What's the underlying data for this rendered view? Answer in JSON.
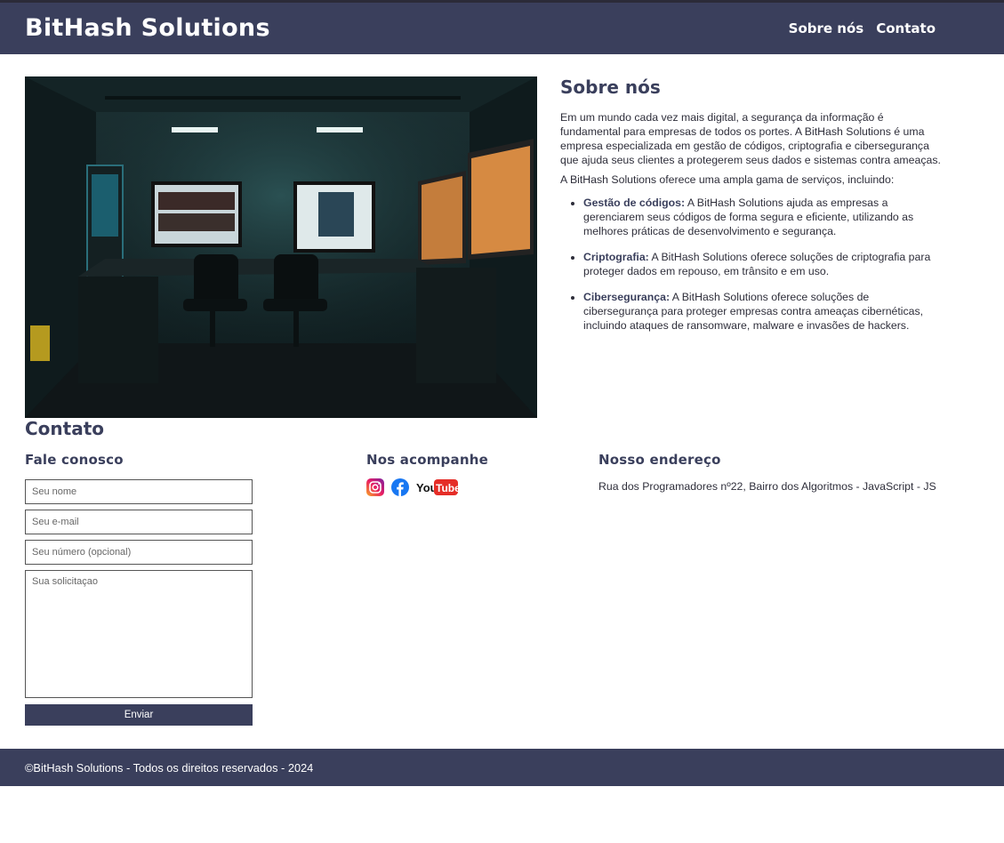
{
  "header": {
    "brand": "BitHash Solutions",
    "nav": [
      "Sobre nós",
      "Contato"
    ]
  },
  "about": {
    "title": "Sobre nós",
    "paragraph1": "Em um mundo cada vez mais digital, a segurança da informação é fundamental para empresas de todos os portes. A BitHash Solutions é uma empresa especializada em gestão de códigos, criptografia e cibersegurança que ajuda seus clientes a protegerem seus dados e sistemas contra ameaças.",
    "paragraph2": "A BitHash Solutions oferece uma ampla gama de serviços, incluindo:",
    "services": [
      {
        "name": "Gestão de códigos:",
        "text": " A BitHash Solutions ajuda as empresas a gerenciarem seus códigos de forma segura e eficiente, utilizando as melhores práticas de desenvolvimento e segurança."
      },
      {
        "name": "Criptografia:",
        "text": " A BitHash Solutions oferece soluções de criptografia para proteger dados em repouso, em trânsito e em uso."
      },
      {
        "name": "Cibersegurança:",
        "text": " A BitHash Solutions oferece soluções de cibersegurança para proteger empresas contra ameaças cibernéticas, incluindo ataques de ransomware, malware e invasões de hackers."
      }
    ]
  },
  "contact": {
    "title": "Contato",
    "form_title": "Fale conosco",
    "name_placeholder": "Seu nome",
    "email_placeholder": "Seu e-mail",
    "phone_placeholder": "Seu número (opcional)",
    "message_placeholder": "Sua solicitaçao",
    "submit_label": "Enviar",
    "social_title": "Nos acompanhe",
    "social_icons": [
      "instagram-icon",
      "facebook-icon",
      "youtube-icon"
    ],
    "youtube_you": "You",
    "youtube_tube": "Tube",
    "address_title": "Nosso endereço",
    "address": "Rua dos Programadores nº22, Bairro dos Algoritmos - JavaScript - JS"
  },
  "footer": {
    "copyright": "©BitHash Solutions - Todos os direitos reservados - 2024"
  },
  "colors": {
    "primary": "#3a3f5c",
    "footer_text": "#ffffff"
  }
}
